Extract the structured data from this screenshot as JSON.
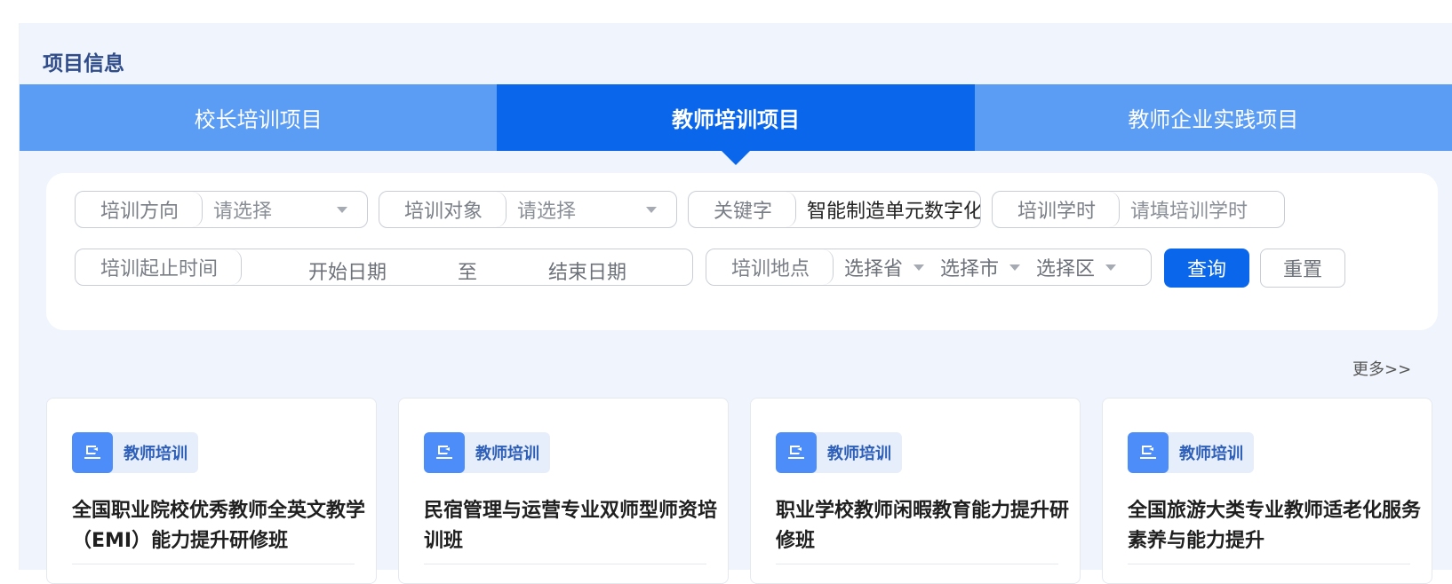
{
  "section": {
    "title": "项目信息"
  },
  "tabs": [
    {
      "label": "校长培训项目",
      "active": false
    },
    {
      "label": "教师培训项目",
      "active": true
    },
    {
      "label": "教师企业实践项目",
      "active": false
    }
  ],
  "filters": {
    "direction": {
      "label": "培训方向",
      "placeholder": "请选择"
    },
    "target": {
      "label": "培训对象",
      "placeholder": "请选择"
    },
    "keyword": {
      "label": "关键字",
      "value": "智能制造单元数字化"
    },
    "hours": {
      "label": "培训学时",
      "placeholder": "请填培训学时"
    },
    "period": {
      "label": "培训起止时间",
      "start": "开始日期",
      "sep": "至",
      "end": "结束日期"
    },
    "location": {
      "label": "培训地点",
      "province": "选择省",
      "city": "选择市",
      "district": "选择区"
    },
    "query_label": "查询",
    "reset_label": "重置"
  },
  "more_label": "更多>>",
  "cards": [
    {
      "badge": "教师培训",
      "title": "全国职业院校优秀教师全英文教学（EMI）能力提升研修班"
    },
    {
      "badge": "教师培训",
      "title": "民宿管理与运营专业双师型师资培训班"
    },
    {
      "badge": "教师培训",
      "title": "职业学校教师闲暇教育能力提升研修班"
    },
    {
      "badge": "教师培训",
      "title": "全国旅游大类专业教师适老化服务素养与能力提升"
    }
  ],
  "colors": {
    "primary": "#0a66ea",
    "tab_inactive": "#5b9cf5",
    "panel_bg": "#f0f5fd",
    "badge_icon": "#4c8dfa"
  },
  "icons": {
    "badge_icon": "teacher-desk-icon",
    "caret": "caret-down-icon"
  }
}
